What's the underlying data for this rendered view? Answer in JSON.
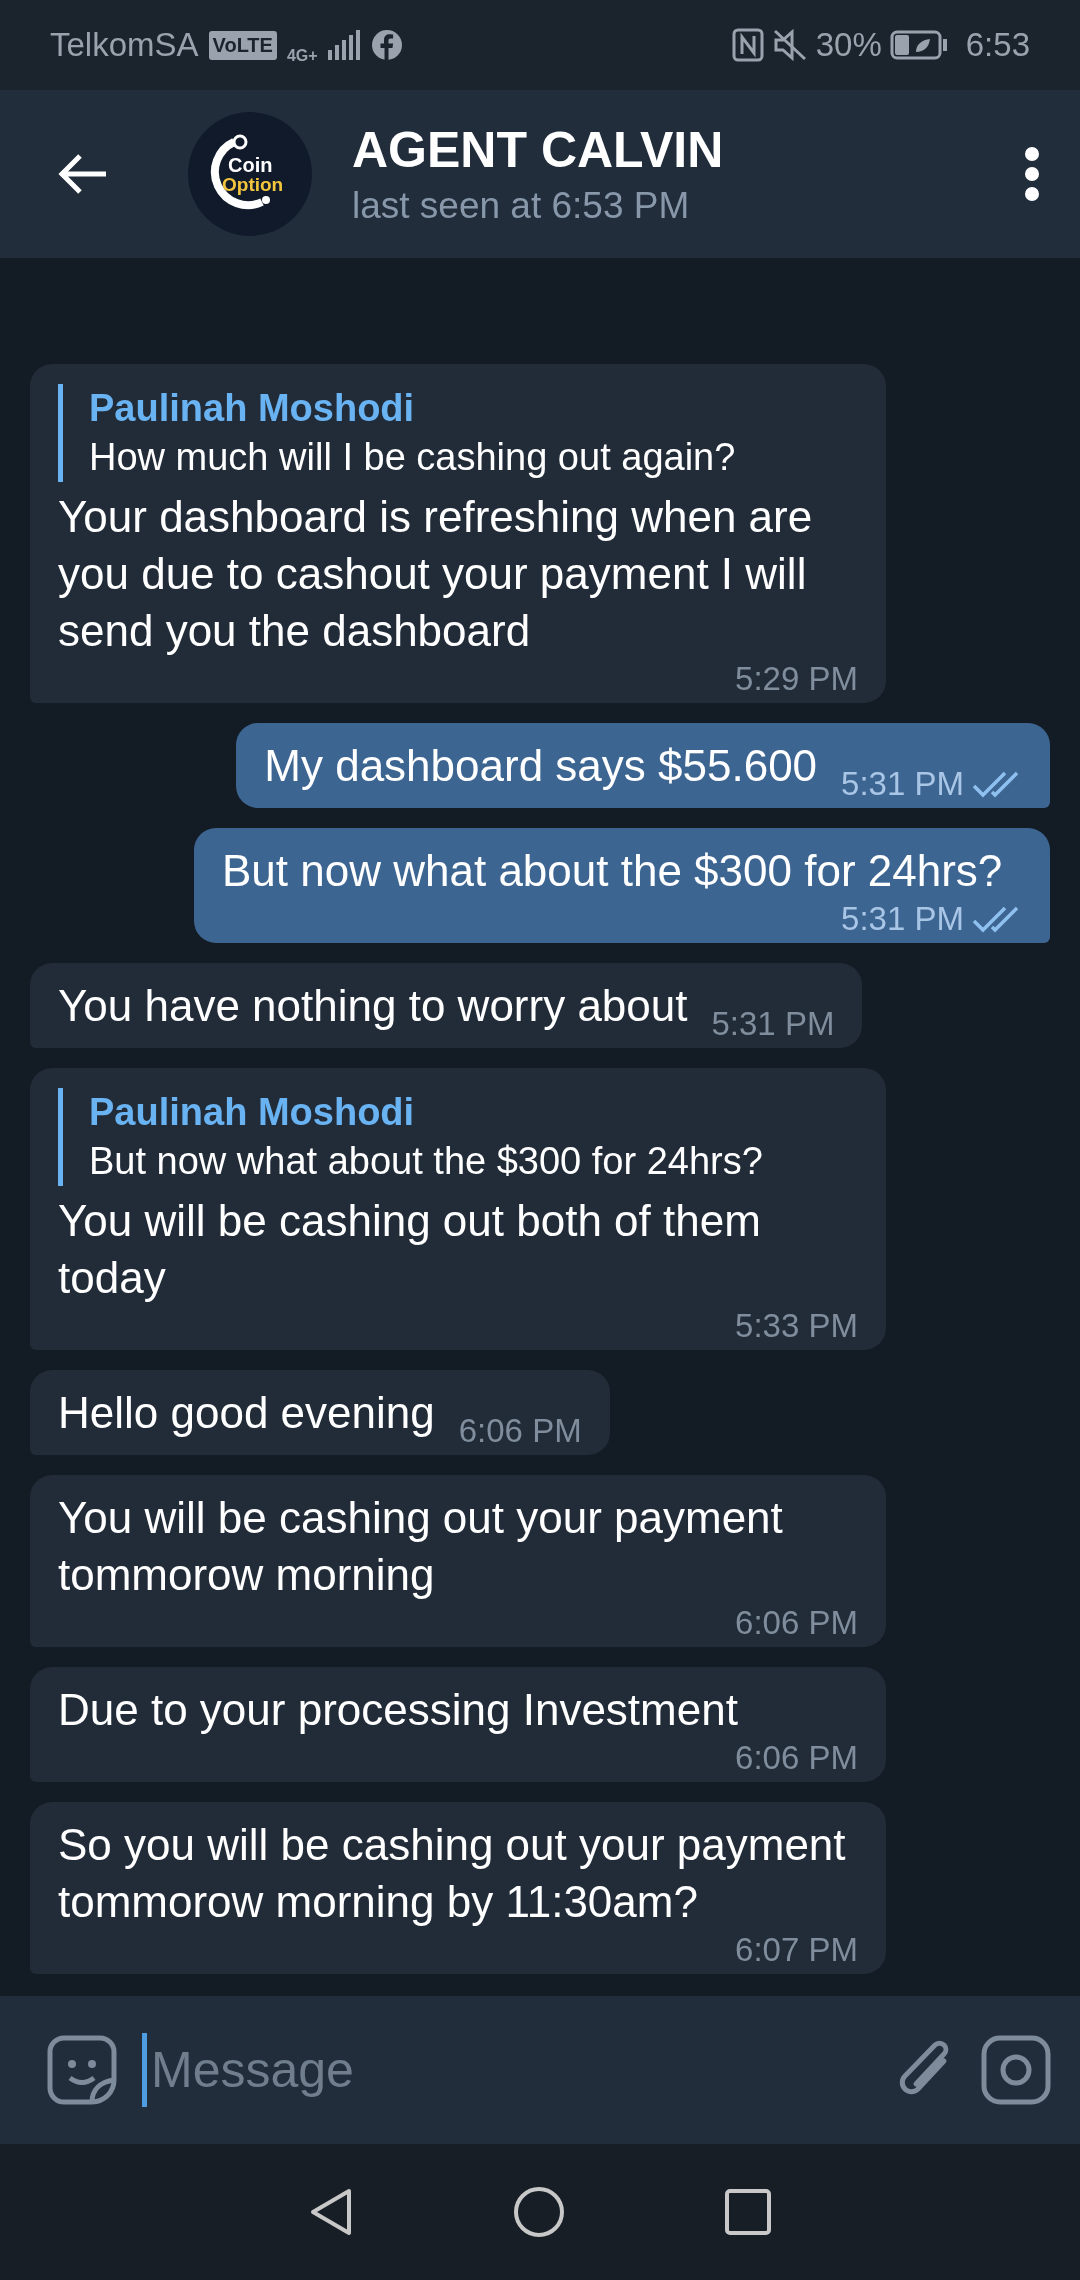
{
  "status_bar": {
    "carrier": "TelkomSA",
    "volte": "VoLTE",
    "network": "4G+",
    "battery": "30%",
    "time": "6:53"
  },
  "header": {
    "logo_top": "Coin",
    "logo_bottom": "Option",
    "title": "AGENT CALVIN",
    "subtitle": "last seen at 6:53 PM"
  },
  "messages": [
    {
      "kind": "incoming",
      "reply": {
        "name": "Paulinah Moshodi",
        "text": "How much will I be cashing out again?"
      },
      "text": "Your dashboard is refreshing when are you due to cashout your payment I will send you the dashboard",
      "time": "5:29 PM"
    },
    {
      "kind": "outgoing",
      "text": "My dashboard says $55.600",
      "time": "5:31 PM",
      "read": true
    },
    {
      "kind": "outgoing",
      "text": "But now what about the $300 for 24hrs?",
      "time": "5:31 PM",
      "read": true
    },
    {
      "kind": "incoming",
      "text": "You have nothing to worry about",
      "time": "5:31 PM"
    },
    {
      "kind": "incoming",
      "reply": {
        "name": "Paulinah Moshodi",
        "text": "But now what about the $300 for 24hrs?"
      },
      "text": "You will be cashing out both of them today",
      "time": "5:33 PM"
    },
    {
      "kind": "incoming",
      "text": "Hello good evening",
      "time": "6:06 PM"
    },
    {
      "kind": "incoming",
      "text": "You will be cashing out your payment tommorow morning",
      "time": "6:06 PM"
    },
    {
      "kind": "incoming",
      "text": "Due to your processing Investment",
      "time": "6:06 PM"
    },
    {
      "kind": "incoming",
      "text": "So you will be cashing out your payment tommorow morning by 11:30am?",
      "time": "6:07 PM"
    }
  ],
  "composer": {
    "placeholder": "Message"
  }
}
